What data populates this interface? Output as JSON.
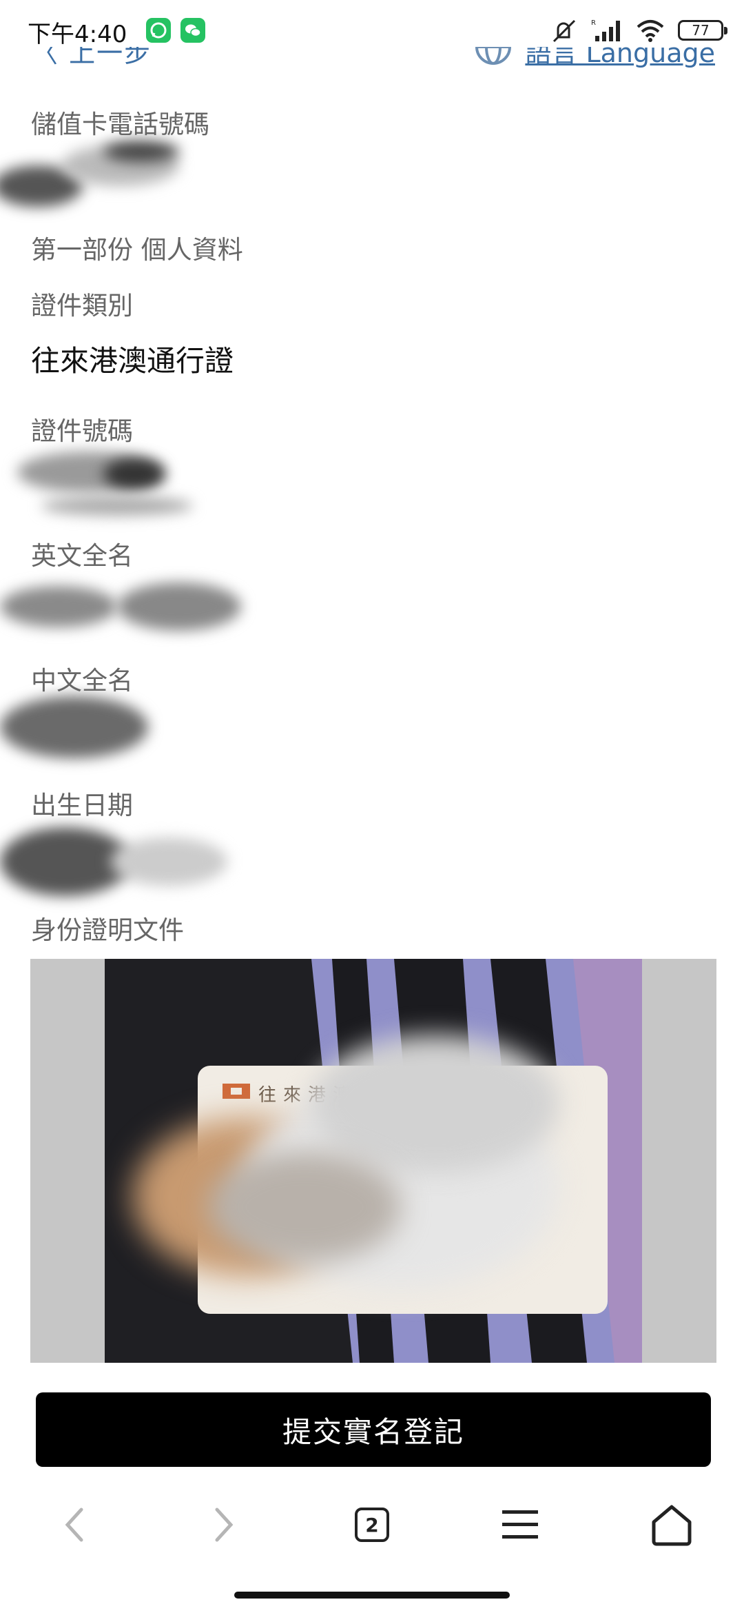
{
  "status_bar": {
    "time": "下午4:40",
    "battery_level": "77",
    "icons": [
      "whatsapp-icon",
      "wechat-icon",
      "mute-icon",
      "signal-icon",
      "wifi-icon",
      "battery-icon"
    ]
  },
  "nav": {
    "back_label": "〈 上一步",
    "language_label": "語言 Language"
  },
  "form": {
    "phone_label": "儲值卡電話號碼",
    "section_title": "第一部份 個人資料",
    "id_type_label": "證件類別",
    "id_type_value": "往來港澳通行證",
    "id_number_label": "證件號碼",
    "english_name_label": "英文全名",
    "chinese_name_label": "中文全名",
    "dob_label": "出生日期",
    "id_document_label": "身份證明文件",
    "card_text": "往來港澳通行證"
  },
  "submit_label": "提交實名登記",
  "browser": {
    "tab_count": "2"
  },
  "colors": {
    "link": "#3a6ea5",
    "label": "#666666",
    "submit_bg": "#000000"
  }
}
